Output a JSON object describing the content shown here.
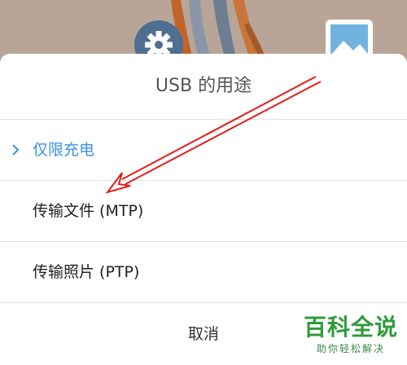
{
  "dialog": {
    "title": "USB 的用途",
    "options": [
      {
        "label": "仅限充电",
        "selected": true
      },
      {
        "label": "传输文件 (MTP)",
        "selected": false
      },
      {
        "label": "传输照片 (PTP)",
        "selected": false
      }
    ],
    "cancel_label": "取消"
  },
  "watermark": {
    "title": "百科全说",
    "subtitle": "助你轻松解决"
  },
  "icons": [
    "settings-gear-icon",
    "gallery-icon",
    "chevron-right-icon"
  ],
  "colors": {
    "accent": "#3b93e6",
    "annotation": "#e21d1d",
    "watermark": "#2e9b3c"
  }
}
